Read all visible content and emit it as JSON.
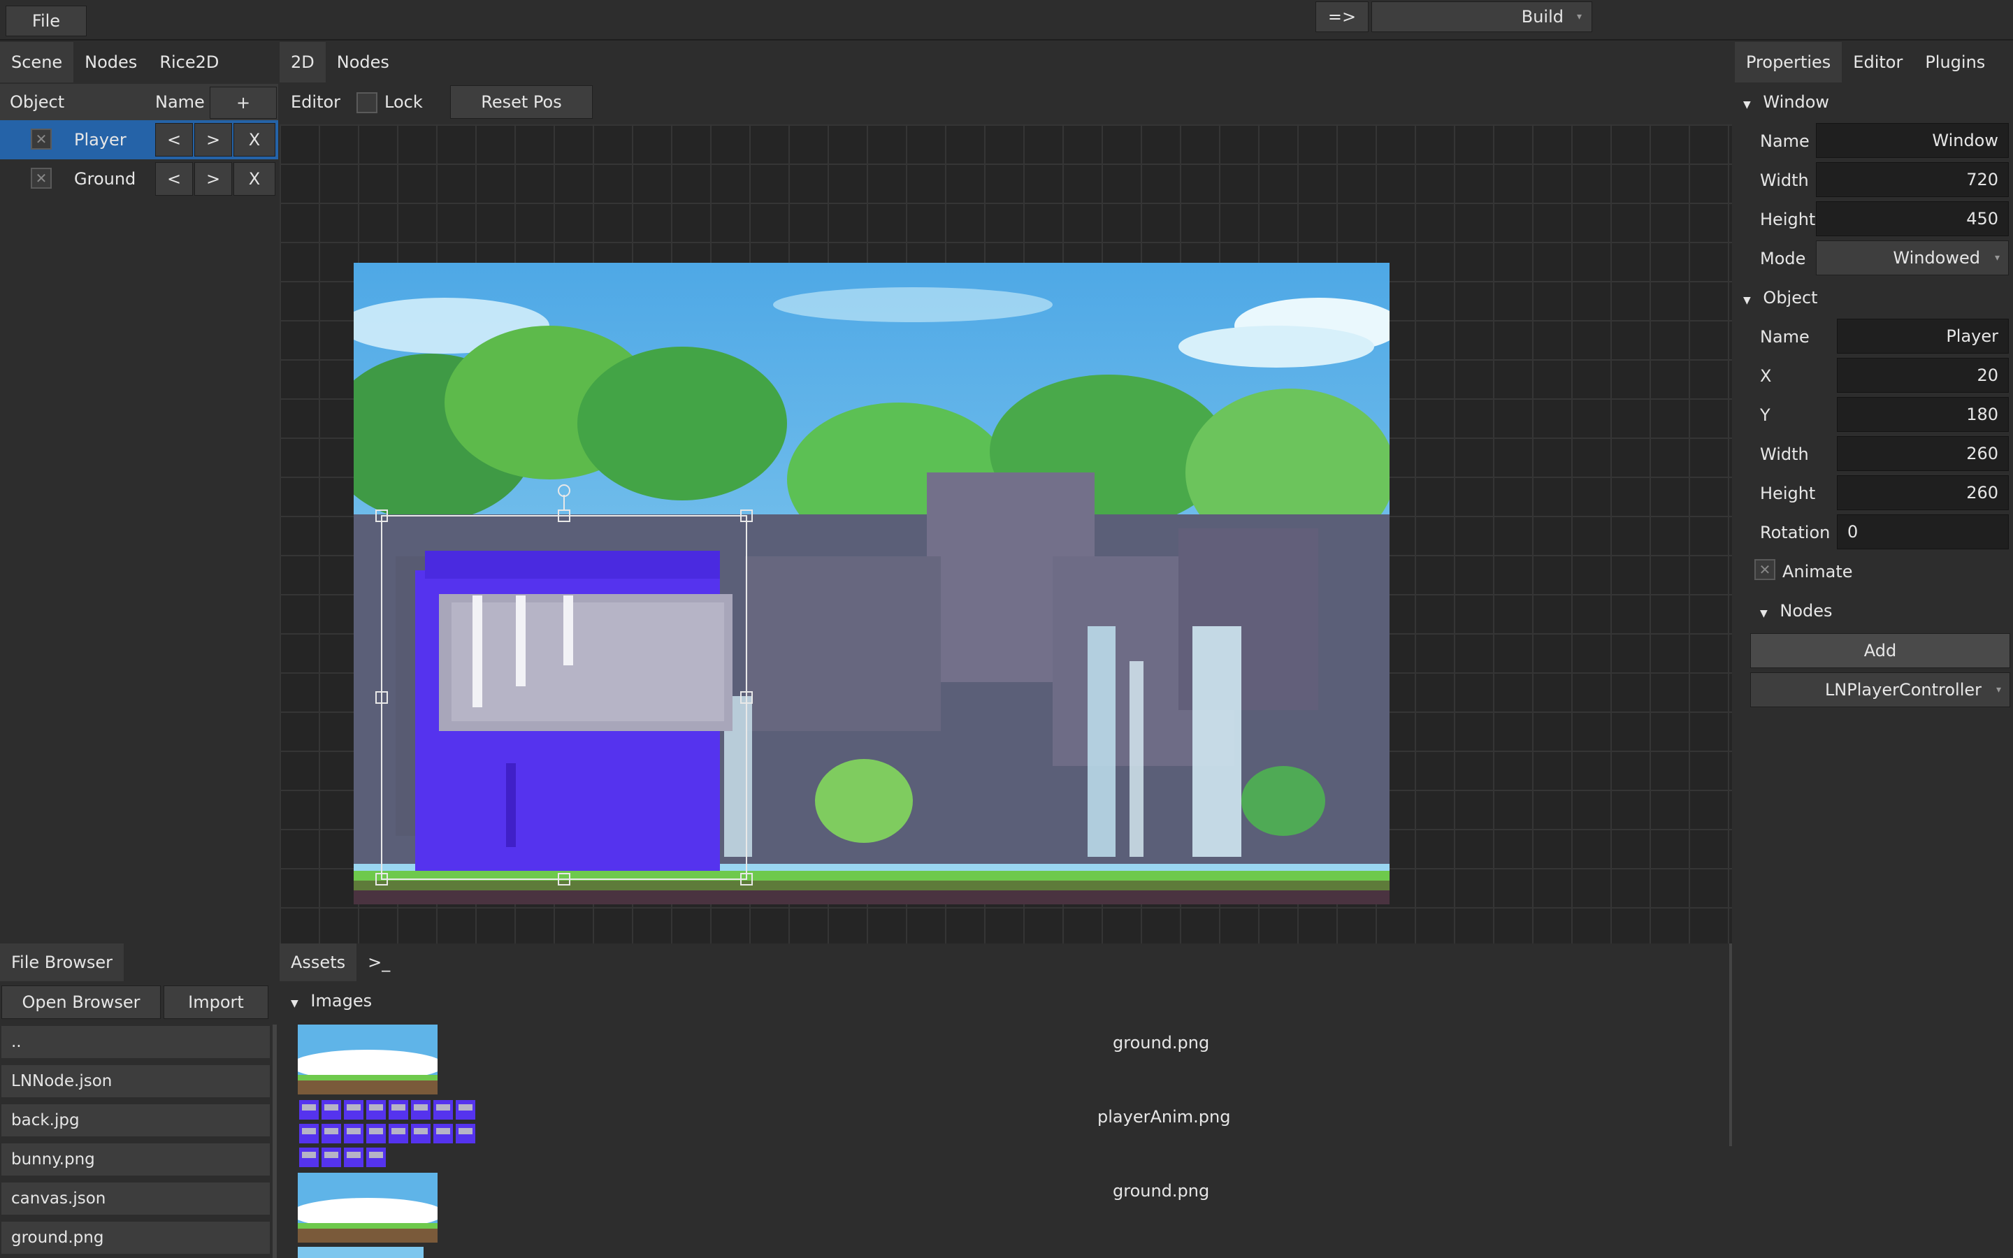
{
  "menu": {
    "file_label": "File"
  },
  "build": {
    "arrow_label": "=>",
    "build_label": "Build"
  },
  "left_tabs": [
    "Scene",
    "Nodes",
    "Rice2D"
  ],
  "scene": {
    "col_object": "Object",
    "col_name": "Name",
    "add_label": "+",
    "items": [
      {
        "name": "Player",
        "prev": "<",
        "next": ">",
        "remove": "X",
        "checked": "✕"
      },
      {
        "name": "Ground",
        "prev": "<",
        "next": ">",
        "remove": "X",
        "checked": "✕"
      }
    ]
  },
  "center_tabs": [
    "2D",
    "Nodes"
  ],
  "editor_bar": {
    "editor_label": "Editor",
    "lock_label": "Lock",
    "reset_label": "Reset Pos"
  },
  "right_tabs": [
    "Properties",
    "Editor",
    "Plugins"
  ],
  "properties": {
    "window_section": "Window",
    "window": {
      "name_label": "Name",
      "name_value": "Window",
      "width_label": "Width",
      "width_value": "720",
      "height_label": "Height",
      "height_value": "450",
      "mode_label": "Mode",
      "mode_value": "Windowed"
    },
    "object_section": "Object",
    "object": {
      "name_label": "Name",
      "name_value": "Player",
      "x_label": "X",
      "x_value": "20",
      "y_label": "Y",
      "y_value": "180",
      "width_label": "Width",
      "width_value": "260",
      "height_label": "Height",
      "height_value": "260",
      "rotation_label": "Rotation",
      "rotation_value": "0",
      "animate_label": "Animate",
      "animate_check": "✕"
    },
    "nodes_section": "Nodes",
    "add_label": "Add",
    "controller_value": "LNPlayerController"
  },
  "file_browser": {
    "tab": "File Browser",
    "open_label": "Open Browser",
    "import_label": "Import",
    "items": [
      "..",
      "LNNode.json",
      "back.jpg",
      "bunny.png",
      "canvas.json",
      "ground.png"
    ]
  },
  "assets": {
    "tab": "Assets",
    "console_tab": ">_",
    "images_section": "Images",
    "items": [
      "ground.png",
      "playerAnim.png",
      "ground.png"
    ]
  },
  "colors": {
    "selection": "#2563a8",
    "player": "#5533ee",
    "sky": "#5fb4e8"
  }
}
